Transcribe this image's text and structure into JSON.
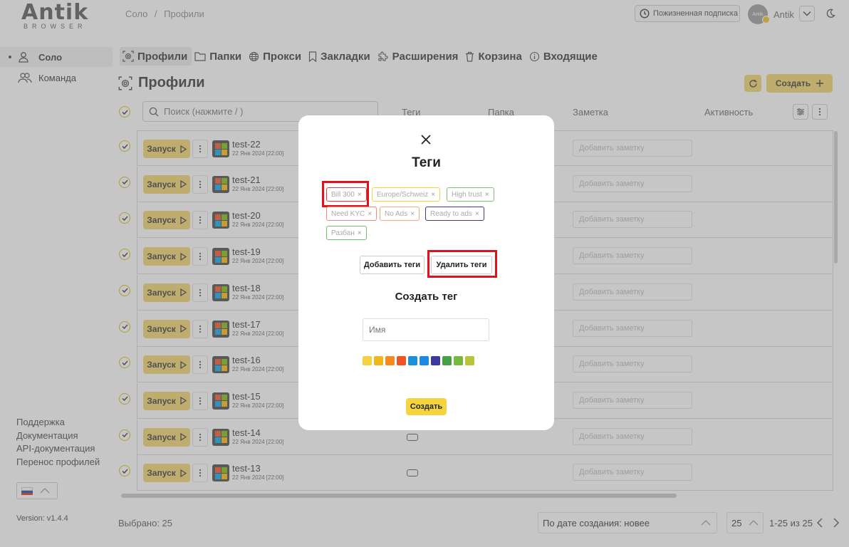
{
  "app": {
    "logo_main": "Antik",
    "logo_sub": "BROWSER",
    "breadcrumb": [
      "Соло",
      "/",
      "Профили"
    ]
  },
  "header": {
    "subscription_label": "Пожизненная подписка",
    "user_name": "Antik",
    "avatar_text": "Antik"
  },
  "sidebar": {
    "items": [
      {
        "label": "Соло",
        "icon": "user-icon",
        "active": true
      },
      {
        "label": "Команда",
        "icon": "team-icon",
        "active": false
      }
    ],
    "links": [
      "Поддержка",
      "Документация",
      "API-документация",
      "Перенос профилей"
    ],
    "version": "Version: v1.4.4"
  },
  "tabs": [
    {
      "label": "Профили",
      "icon": "fingerprint-icon",
      "active": true
    },
    {
      "label": "Папки",
      "icon": "folder-icon"
    },
    {
      "label": "Прокси",
      "icon": "globe-icon"
    },
    {
      "label": "Закладки",
      "icon": "bookmark-icon"
    },
    {
      "label": "Расширения",
      "icon": "puzzle-icon"
    },
    {
      "label": "Корзина",
      "icon": "trash-icon"
    },
    {
      "label": "Входящие",
      "icon": "info-icon"
    }
  ],
  "page": {
    "title": "Профили",
    "create_label": "Создать",
    "search_placeholder": "Поиск (нажмите / )"
  },
  "table": {
    "columns": [
      "Теги",
      "Папка",
      "Заметка",
      "Активность"
    ],
    "run_label": "Запуск",
    "note_placeholder": "Добавить заметку",
    "rows": [
      {
        "name": "test-22",
        "date": "22 Янв 2024 [22:00]"
      },
      {
        "name": "test-21",
        "date": "22 Янв 2024 [22:00]"
      },
      {
        "name": "test-20",
        "date": "22 Янв 2024 [22:00]"
      },
      {
        "name": "test-19",
        "date": "22 Янв 2024 [22:00]"
      },
      {
        "name": "test-18",
        "date": "22 Янв 2024 [22:00]"
      },
      {
        "name": "test-17",
        "date": "22 Янв 2024 [22:00]"
      },
      {
        "name": "test-16",
        "date": "22 Янв 2024 [22:00]"
      },
      {
        "name": "test-15",
        "date": "22 Янв 2024 [22:00]"
      },
      {
        "name": "test-14",
        "date": "22 Янв 2024 [22:00]"
      },
      {
        "name": "test-13",
        "date": "22 Янв 2024 [22:00]"
      }
    ]
  },
  "footer": {
    "selected": "Выбрано: 25",
    "sort_value": "По дате создания: новее",
    "per_page": "25",
    "range": "1-25 из 25"
  },
  "modal": {
    "title": "Теги",
    "tags": [
      {
        "label": "Bill 300",
        "color": "#e53935"
      },
      {
        "label": "Europe/Schweiz",
        "color": "#f5d33f"
      },
      {
        "label": "High trust",
        "color": "#7cc46a"
      },
      {
        "label": "Need KYC",
        "color": "#f08a7a"
      },
      {
        "label": "No Ads",
        "color": "#f4a57a"
      },
      {
        "label": "Ready to ads",
        "color": "#3b3b8f"
      },
      {
        "label": "Разбан",
        "color": "#6fbf6a"
      }
    ],
    "add_tags_label": "Добавить теги",
    "delete_tags_label": "Удалить теги",
    "create_tag_title": "Создать тег",
    "name_placeholder": "Имя",
    "create_label": "Создать",
    "swatch_colors": [
      "#f5d33f",
      "#f2b51a",
      "#f58a1f",
      "#ee5522",
      "#1e90d8",
      "#1e88e5",
      "#3b3b9f",
      "#46a046",
      "#77b83f",
      "#b8c43a"
    ]
  }
}
